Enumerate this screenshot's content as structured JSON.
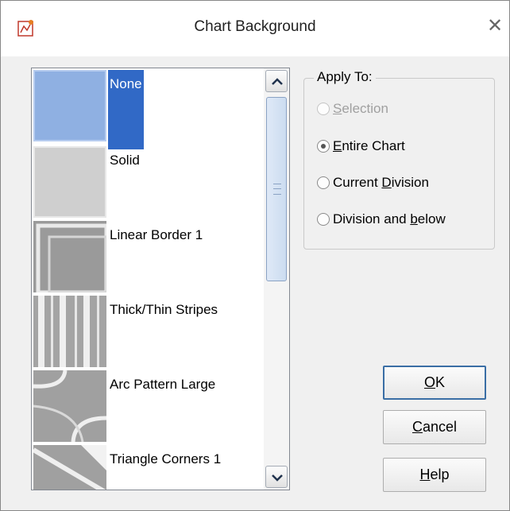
{
  "window": {
    "title": "Chart Background",
    "close_glyph": "✕"
  },
  "icons": {
    "app": "chart-background-app-icon",
    "close": "close-icon",
    "scroll_up": "chevron-up-icon",
    "scroll_down": "chevron-down-icon"
  },
  "colors": {
    "selection": "#3169c6",
    "selected_thumb": "#7f9fd8",
    "thumb_gray": "#bdbdbd",
    "default_button_border": "#3a6ea5"
  },
  "pattern_list": {
    "selected_index": 0,
    "items": [
      {
        "label": "None"
      },
      {
        "label": "Solid"
      },
      {
        "label": "Linear Border 1"
      },
      {
        "label": "Thick/Thin Stripes"
      },
      {
        "label": "Arc Pattern Large"
      },
      {
        "label": "Triangle Corners 1"
      }
    ]
  },
  "apply_to": {
    "legend": "Apply To:",
    "options": [
      {
        "label_pre": "",
        "mnemonic": "S",
        "label_post": "election",
        "checked": false,
        "disabled": true
      },
      {
        "label_pre": "",
        "mnemonic": "E",
        "label_post": "ntire Chart",
        "checked": true,
        "disabled": false
      },
      {
        "label_pre": "Current ",
        "mnemonic": "D",
        "label_post": "ivision",
        "checked": false,
        "disabled": false
      },
      {
        "label_pre": "Division and ",
        "mnemonic": "b",
        "label_post": "elow",
        "checked": false,
        "disabled": false
      }
    ]
  },
  "buttons": {
    "ok": {
      "mnemonic": "O",
      "rest": "K"
    },
    "cancel": {
      "mnemonic": "C",
      "rest": "ancel"
    },
    "help": {
      "mnemonic": "H",
      "rest": "elp"
    }
  }
}
